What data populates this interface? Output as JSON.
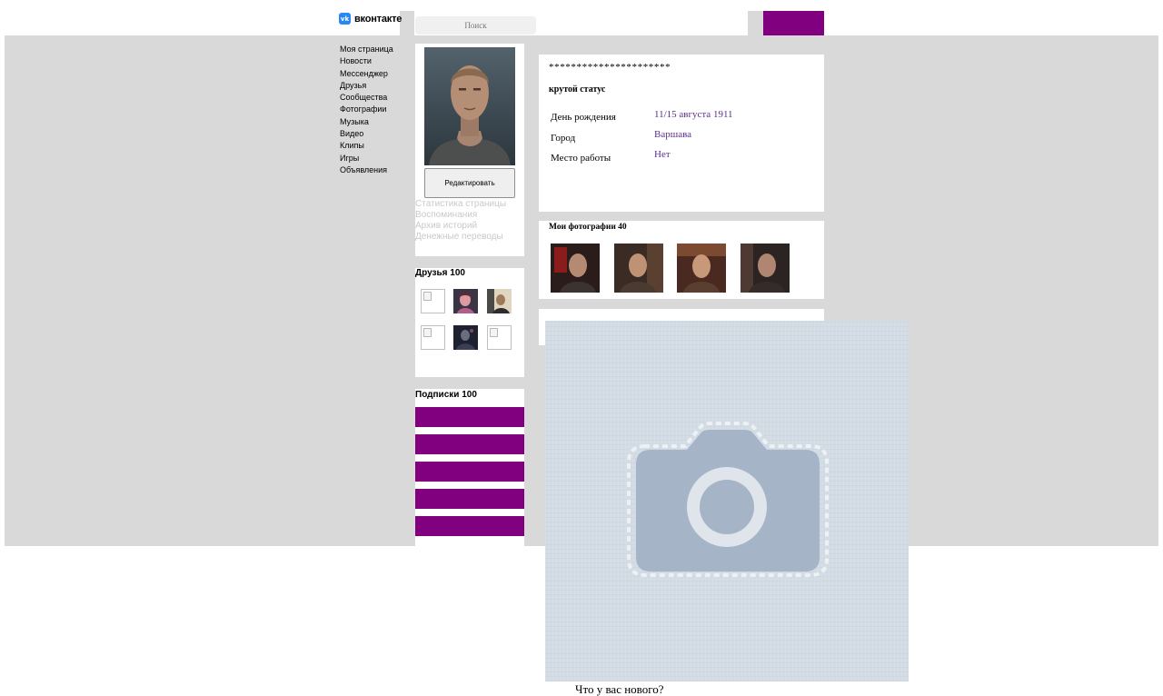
{
  "header": {
    "logo_text": "вконтакте",
    "logo_icon": "vk-logo-icon",
    "search_placeholder": "Поиск",
    "accent_color": "#800080"
  },
  "left_menu": [
    "Моя страница",
    "Новости",
    "Мессенджер",
    "Друзья",
    "Сообщества",
    "Фотографии",
    "Музыка",
    "Видео",
    "Клипы",
    "Игры",
    "Объявления"
  ],
  "profile": {
    "edit_label": "Редактировать",
    "links": [
      "Статистика страницы",
      "Воспоминания",
      "Архив историй",
      "Денежные переводы"
    ]
  },
  "friends": {
    "title": "Друзья 100"
  },
  "subscriptions": {
    "title": "Подписки 100"
  },
  "info": {
    "name": "**********************",
    "status": "крутой статус",
    "rows": [
      {
        "label": "День рождения",
        "value": "11/15 августа 1911"
      },
      {
        "label": "Город",
        "value": "Варшава"
      },
      {
        "label": "Место работы",
        "value": "Нет"
      }
    ]
  },
  "photos": {
    "title": "Мои фотографии 40"
  },
  "wall": {
    "placeholder_icon": "camera-icon",
    "prompt": "Что у вас нового?"
  },
  "colors": {
    "background_band": "#d9d9d9",
    "link_value": "#5e2d91",
    "placeholder_bg": "#d3dce5",
    "camera": "#a5b4c6"
  }
}
